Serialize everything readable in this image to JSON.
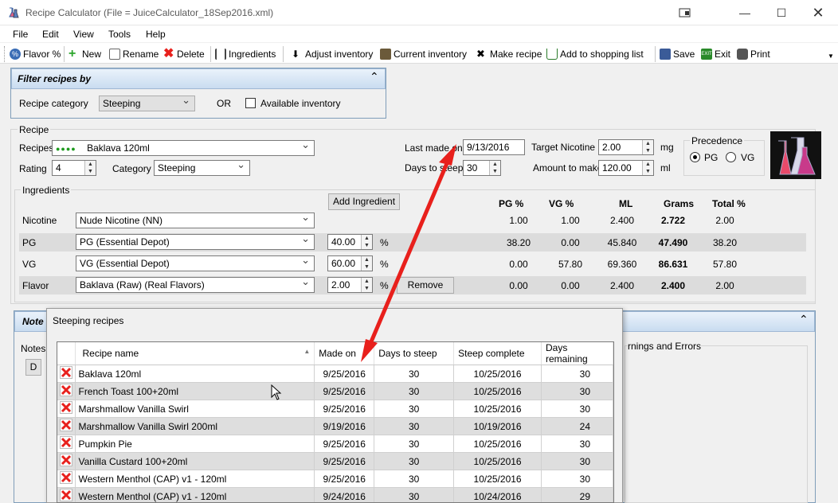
{
  "window": {
    "title": "Recipe Calculator (File = JuiceCalculator_18Sep2016.xml)"
  },
  "menu": [
    "File",
    "Edit",
    "View",
    "Tools",
    "Help"
  ],
  "toolbar": {
    "flavor": "Flavor %",
    "new": "New",
    "rename": "Rename",
    "delete": "Delete",
    "ingredients": "Ingredients",
    "adjust": "Adjust inventory",
    "current": "Current inventory",
    "make": "Make recipe",
    "shopping": "Add to shopping list",
    "save": "Save",
    "exit": "Exit",
    "print": "Print"
  },
  "filter": {
    "title": "Filter recipes by",
    "category_label": "Recipe category",
    "category_value": "Steeping",
    "or": "OR",
    "available_label": "Available inventory"
  },
  "recipe": {
    "group": "Recipe",
    "recipes_label": "Recipes",
    "recipes_value": "Baklava 120ml",
    "rating_label": "Rating",
    "rating_value": "4",
    "category_label": "Category",
    "category_value": "Steeping",
    "last_made_label": "Last made on",
    "last_made_value": "9/13/2016",
    "days_label": "Days to steep",
    "days_value": "30",
    "target_nic_label": "Target Nicotine",
    "target_nic_value": "2.00",
    "target_nic_unit": "mg",
    "amount_label": "Amount to make",
    "amount_value": "120.00",
    "amount_unit": "ml",
    "precedence_label": "Precedence",
    "pg": "PG",
    "vg": "VG"
  },
  "ingredients": {
    "group": "Ingredients",
    "add_button": "Add Ingredient",
    "headers": [
      "PG %",
      "VG %",
      "ML",
      "Grams",
      "Total %"
    ],
    "rows": [
      {
        "label": "Nicotine",
        "name": "Nude Nicotine (NN)",
        "pct": "",
        "pg": "1.00",
        "vg": "1.00",
        "ml": "2.400",
        "grams": "2.722",
        "total": "2.00"
      },
      {
        "label": "PG",
        "name": "PG (Essential Depot)",
        "pct": "40.00",
        "pg": "38.20",
        "vg": "0.00",
        "ml": "45.840",
        "grams": "47.490",
        "total": "38.20"
      },
      {
        "label": "VG",
        "name": "VG (Essential Depot)",
        "pct": "60.00",
        "pg": "0.00",
        "vg": "57.80",
        "ml": "69.360",
        "grams": "86.631",
        "total": "57.80"
      },
      {
        "label": "Flavor",
        "name": "Baklava (Raw) (Real Flavors)",
        "pct": "2.00",
        "pg": "0.00",
        "vg": "0.00",
        "ml": "2.400",
        "grams": "2.400",
        "total": "2.00"
      }
    ],
    "percent": "%",
    "remove": "Remove"
  },
  "notes": {
    "title": "Note",
    "label": "Notes",
    "d_button": "D",
    "warnings": "rnings and Errors"
  },
  "steeping": {
    "title": "Steeping recipes",
    "columns": [
      "Recipe name",
      "Made on",
      "Days to steep",
      "Steep complete",
      "Days remaining"
    ],
    "rows": [
      [
        "Baklava 120ml",
        "9/25/2016",
        "30",
        "10/25/2016",
        "30"
      ],
      [
        "French Toast 100+20ml",
        "9/25/2016",
        "30",
        "10/25/2016",
        "30"
      ],
      [
        "Marshmallow Vanilla Swirl",
        "9/25/2016",
        "30",
        "10/25/2016",
        "30"
      ],
      [
        "Marshmallow Vanilla Swirl 200ml",
        "9/19/2016",
        "30",
        "10/19/2016",
        "24"
      ],
      [
        "Pumpkin Pie",
        "9/25/2016",
        "30",
        "10/25/2016",
        "30"
      ],
      [
        "Vanilla Custard 100+20ml",
        "9/25/2016",
        "30",
        "10/25/2016",
        "30"
      ],
      [
        "Western Menthol (CAP) v1 - 120ml",
        "9/25/2016",
        "30",
        "10/25/2016",
        "30"
      ],
      [
        "Western Menthol (CAP) v1 - 120ml",
        "9/24/2016",
        "30",
        "10/24/2016",
        "29"
      ]
    ]
  },
  "colors": {
    "accent_red": "#e8201c",
    "header_blue": "#c9dcf0",
    "dot_green": "#1e9b1e"
  }
}
